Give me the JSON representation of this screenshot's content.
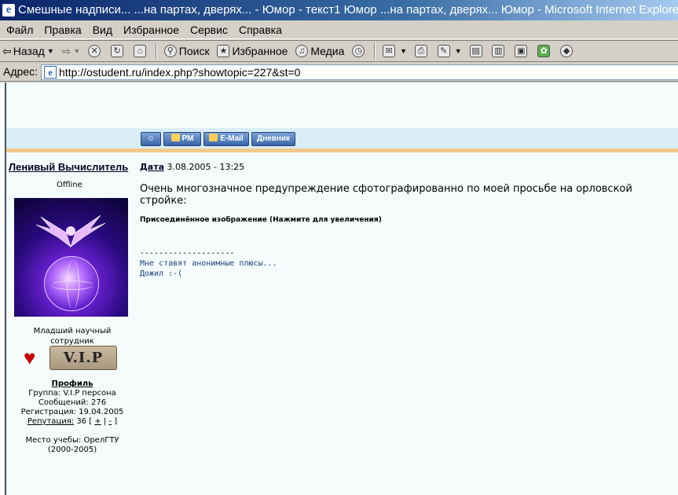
{
  "window": {
    "title": "Смешные надписи... ...на партах, дверях... - Юмор - текст1 Юмор ...на партах, дверях... Юмор - Microsoft Internet Explorer"
  },
  "menu": {
    "items": [
      "Файл",
      "Правка",
      "Вид",
      "Избранное",
      "Сервис",
      "Справка"
    ]
  },
  "toolbar": {
    "back_label": "Назад",
    "search_label": "Поиск",
    "favorites_label": "Избранное",
    "media_label": "Медиа"
  },
  "address": {
    "label": "Адрес:",
    "url": "http://ostudent.ru/index.php?showtopic=227&st=0"
  },
  "post_buttons": {
    "pm": "PM",
    "email": "E-Mail",
    "diary": "Дневник"
  },
  "author": {
    "name": "Ленивый Вычислитель",
    "status": "Offline",
    "rank_line1": "Младший научный",
    "rank_line2": "сотрудник",
    "badge": "V.I.P",
    "profile_title": "Профиль",
    "group": "Группа: V.I.P персона",
    "posts": "Сообщений: 276",
    "registered": "Регистрация: 19.04.2005",
    "reputation_label": "Репутация:",
    "reputation_value": "36 [",
    "rep_plus": "+",
    "rep_sep": "|",
    "rep_minus": "-",
    "rep_close": "]",
    "study_line1": "Место учебы: ОрелГТУ",
    "study_line2": "(2000-2005)"
  },
  "post": {
    "date_label": "Дата",
    "date_value": "3.08.2005 - 13:25",
    "text": "Очень многозначное предупреждение сфотографированно по моей просьбе на орловской стройке:",
    "attachment": "Присоединённое изображение (Нажмите для увеличения)",
    "sig_divider": "--------------------",
    "sig_line1": "Мне ставят анонимные плюсы...",
    "sig_line2": "Дожил :-("
  }
}
